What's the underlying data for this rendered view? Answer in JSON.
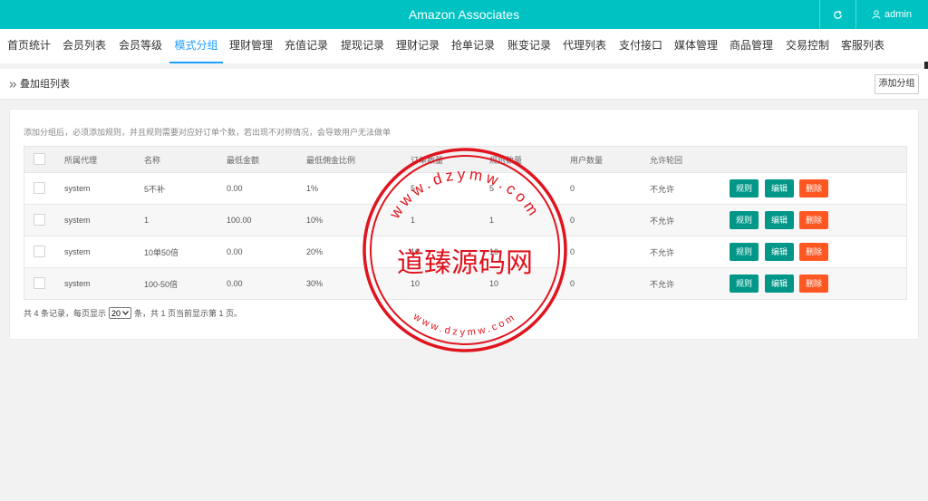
{
  "app": {
    "title": "Amazon Associates",
    "user": "admin"
  },
  "nav": {
    "items": [
      "首页统计",
      "会员列表",
      "会员等级",
      "模式分组",
      "理财管理",
      "充值记录",
      "提现记录",
      "理财记录",
      "抢单记录",
      "账变记录",
      "代理列表",
      "支付接口",
      "媒体管理",
      "商品管理",
      "交易控制",
      "客服列表"
    ],
    "active_index": 3
  },
  "breadcrumb": {
    "label": "叠加组列表"
  },
  "toolbar": {
    "add_group": "添加分组"
  },
  "tip": "添加分组后，必须添加规则，并且规则需要对应好订单个数，若出现不对称情况，会导致用户无法做单",
  "table": {
    "columns": [
      "所属代理",
      "名称",
      "最低金额",
      "最低佣金比例",
      "订单数量",
      "规则数量",
      "用户数量",
      "允许轮回"
    ],
    "rows": [
      {
        "agent": "system",
        "name": "5不补",
        "min_amount": "0.00",
        "min_rate": "1%",
        "orders": "5",
        "rules": "5",
        "users": "0",
        "loop": "不允许"
      },
      {
        "agent": "system",
        "name": "1",
        "min_amount": "100.00",
        "min_rate": "10%",
        "orders": "1",
        "rules": "1",
        "users": "0",
        "loop": "不允许"
      },
      {
        "agent": "system",
        "name": "10单50倍",
        "min_amount": "0.00",
        "min_rate": "20%",
        "orders": "10",
        "rules": "10",
        "users": "0",
        "loop": "不允许"
      },
      {
        "agent": "system",
        "name": "100-50倍",
        "min_amount": "0.00",
        "min_rate": "30%",
        "orders": "10",
        "rules": "10",
        "users": "0",
        "loop": "不允许"
      }
    ],
    "actions": {
      "rule": "规则",
      "edit": "编辑",
      "delete": "删除"
    }
  },
  "pager": {
    "prefix": "共 4 条记录，每页显示",
    "page_size": "20",
    "suffix": "条，共 1 页当前显示第 1 页。"
  },
  "watermark": {
    "text": "道臻源码网",
    "ring_top": "www.dzymw.com",
    "ring_bottom": "www.dzymw.com"
  },
  "colors": {
    "header": "#00c2c2",
    "active_tab": "#1e9fff",
    "btn_primary": "#009688",
    "btn_danger": "#ff5722",
    "stamp": "#e0141e"
  }
}
